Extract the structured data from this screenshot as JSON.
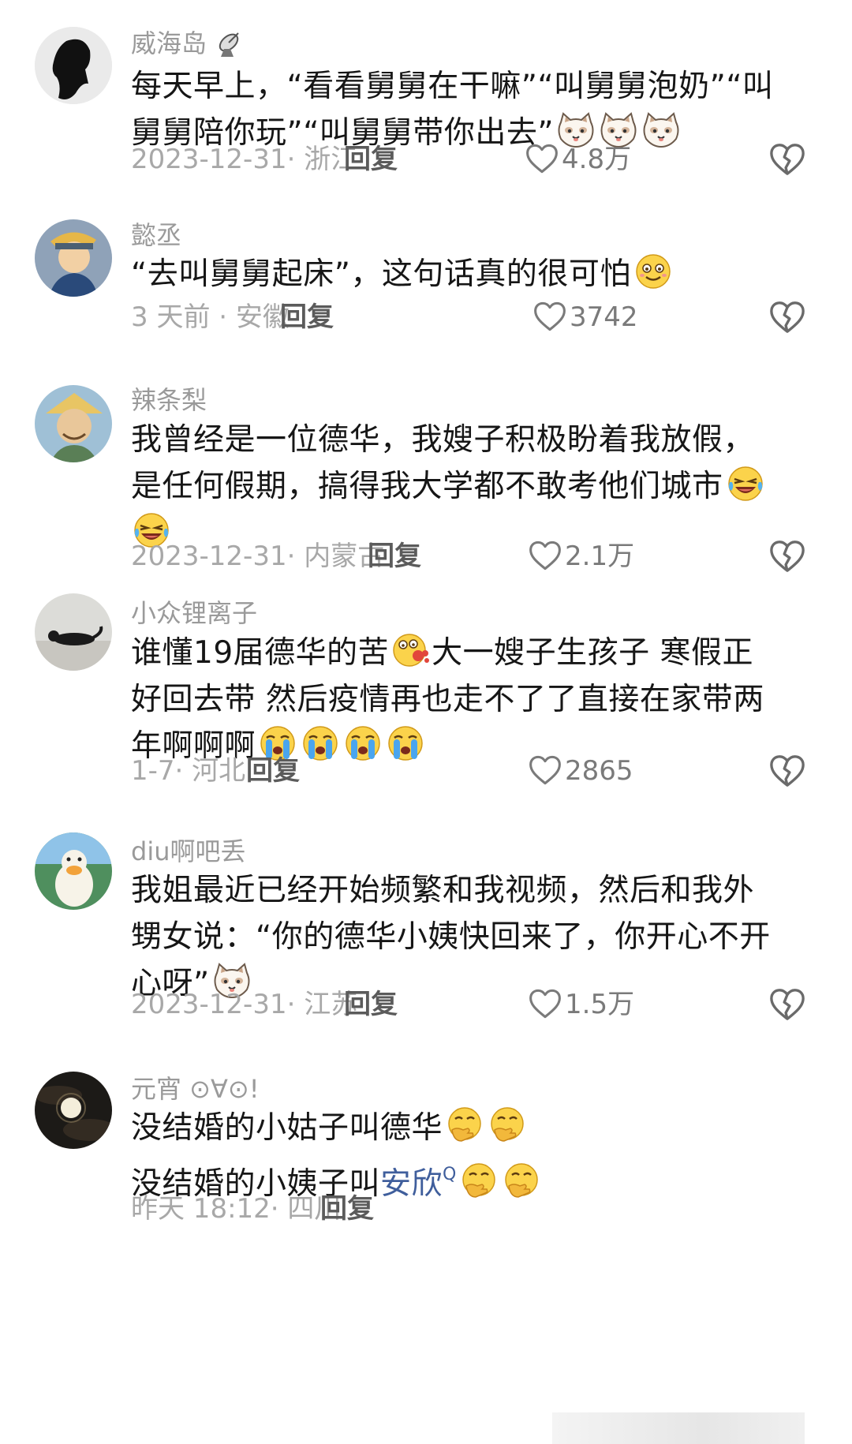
{
  "comments": [
    {
      "username": "威海岛",
      "username_icon": "satellite-dish-icon",
      "lines": [
        "每天早上，“看看舅舅在干嘛”“叫舅舅泡奶”“叫",
        "舅舅陪你玩”“叫舅舅带你出去”"
      ],
      "emojis": [
        "cat-face-icon",
        "cat-face-icon",
        "cat-face-icon"
      ],
      "meta": "2023-12-31· 浙江",
      "reply_label": "回复",
      "likes": "4.8万"
    },
    {
      "username": "懿丞",
      "lines": [
        "“去叫舅舅起床”，这句话真的很可怕"
      ],
      "emojis": [
        "smiling-face-icon"
      ],
      "meta": "3 天前 · 安徽",
      "reply_label": "回复",
      "likes": "3742"
    },
    {
      "username": "辣条梨",
      "lines": [
        "我曾经是一位德华，我嫂子积极盼着我放假，",
        "是任何假期，搞得我大学都不敢考他们城市"
      ],
      "emojis": [
        "laughing-crying-icon",
        "laughing-crying-icon"
      ],
      "meta": "2023-12-31· 内蒙古",
      "reply_label": "回复",
      "likes": "2.1万"
    },
    {
      "username": "小众锂离子",
      "lines": [
        "谁懂19届德华的苦",
        "大一嫂子生孩子 寒假正",
        "好回去带 然后疫情再也走不了了直接在家带两",
        "年啊啊啊"
      ],
      "emojis": [
        "spitting-face-icon",
        "loudly-crying-icon",
        "loudly-crying-icon",
        "loudly-crying-icon",
        "loudly-crying-icon"
      ],
      "meta": "1-7· 河北",
      "reply_label": "回复",
      "likes": "2865"
    },
    {
      "username": "diu啊吧丢",
      "lines": [
        "我姐最近已经开始频繁和我视频，然后和我外",
        "甥女说：“你的德华小姨快回来了，你开心不开",
        "心呀”"
      ],
      "emojis": [
        "cat-face-icon"
      ],
      "meta": "2023-12-31· 江苏",
      "reply_label": "回复",
      "likes": "1.5万"
    },
    {
      "username": "元宵 ⊙∀⊙!",
      "lines": [
        "没结婚的小姑子叫德华",
        "没结婚的小姨子叫",
        "安欣"
      ],
      "emojis": [
        "face-with-hand-icon",
        "face-with-hand-icon",
        "search-superscript-icon",
        "face-with-hand-icon",
        "face-with-hand-icon"
      ],
      "meta": "昨天 18:12· 四川",
      "reply_label": "回复"
    }
  ],
  "search_superscript": "Q",
  "colors": {
    "text": "#161616",
    "username": "#9a9a9a",
    "meta": "#a8a8a8",
    "link": "#3f5e9c",
    "reply": "#5b5b5b"
  }
}
